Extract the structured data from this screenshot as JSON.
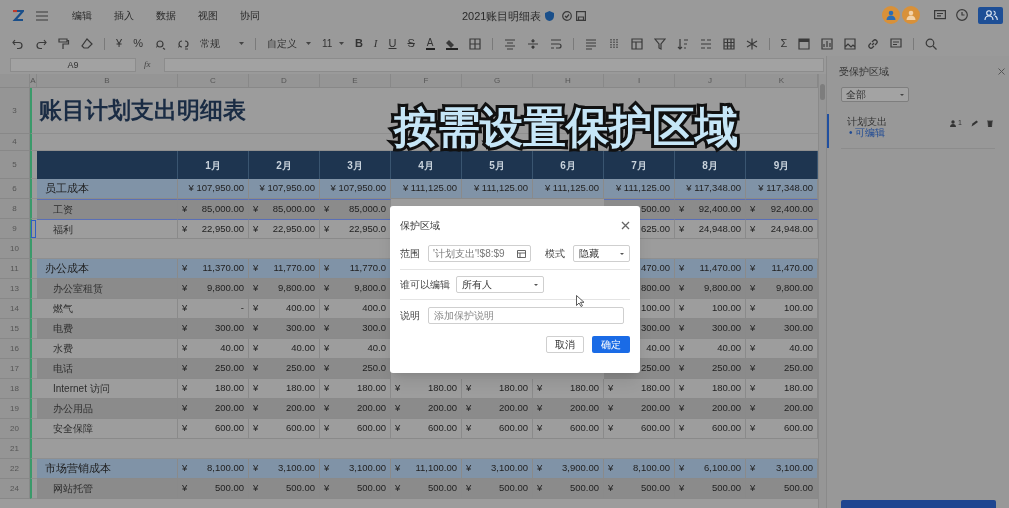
{
  "topbar": {
    "menus": [
      "编辑",
      "插入",
      "数据",
      "视图",
      "协同"
    ],
    "title": "2021账目明细表"
  },
  "toolbar": {
    "texts": [
      "¥",
      "%",
      "常规",
      "自定义",
      "11",
      "B",
      "I",
      "U",
      "S",
      "A",
      "Σ"
    ]
  },
  "formula_bar": {
    "cell": "A9",
    "fx": "fx"
  },
  "sheet": {
    "columns": [
      "A",
      "B",
      "C",
      "D",
      "E",
      "F",
      "G",
      "H",
      "I",
      "J",
      "K"
    ],
    "title_row": "3",
    "title": "账目计划支出明细表",
    "spacer_row": "4",
    "header_row": "5",
    "months": [
      "1月",
      "2月",
      "3月",
      "4月",
      "5月",
      "6月",
      "7月",
      "8月",
      "9月"
    ],
    "rows": [
      {
        "n": "6",
        "kind": "category",
        "label": "员工成本",
        "selected": false,
        "in_range": false,
        "cells": [
          "¥ 107,950.00",
          "¥ 107,950.00",
          "¥ 107,950.00",
          "¥ 111,125.00",
          "¥ 111,125.00",
          "¥ 111,125.00",
          "¥ 111,125.00",
          "¥ 117,348.00",
          "¥ 117,348.00"
        ]
      },
      {
        "n": "8",
        "kind": "item",
        "label": "工资",
        "selected": false,
        "in_range": true,
        "cells": [
          [
            "¥",
            "85,000.00"
          ],
          [
            "¥",
            "85,000.00"
          ],
          [
            "¥",
            "85,000.0"
          ],
          null,
          null,
          null,
          [
            "",
            "500.00"
          ],
          [
            "¥",
            "92,400.00"
          ],
          [
            "¥",
            "92,400.00"
          ]
        ]
      },
      {
        "n": "9",
        "kind": "item",
        "label": "福利",
        "selected": true,
        "in_range": true,
        "cells": [
          [
            "¥",
            "22,950.00"
          ],
          [
            "¥",
            "22,950.00"
          ],
          [
            "¥",
            "22,950.0"
          ],
          null,
          null,
          null,
          [
            "",
            "625.00"
          ],
          [
            "¥",
            "24,948.00"
          ],
          [
            "¥",
            "24,948.00"
          ]
        ]
      },
      {
        "n": "10",
        "kind": "blank",
        "selected": false,
        "in_range": false
      },
      {
        "n": "11",
        "kind": "category",
        "label": "办公成本",
        "selected": false,
        "in_range": false,
        "cells": [
          [
            "¥",
            "11,370.00"
          ],
          [
            "¥",
            "11,770.00"
          ],
          [
            "¥",
            "11,770.0"
          ],
          null,
          null,
          null,
          [
            "",
            "470.00"
          ],
          [
            "¥",
            "11,470.00"
          ],
          [
            "¥",
            "11,470.00"
          ]
        ]
      },
      {
        "n": "13",
        "kind": "item",
        "label": "办公室租赁",
        "selected": false,
        "in_range": false,
        "cells": [
          [
            "¥",
            "9,800.00"
          ],
          [
            "¥",
            "9,800.00"
          ],
          [
            "¥",
            "9,800.0"
          ],
          null,
          null,
          null,
          [
            "",
            "800.00"
          ],
          [
            "¥",
            "9,800.00"
          ],
          [
            "¥",
            "9,800.00"
          ]
        ]
      },
      {
        "n": "14",
        "kind": "item",
        "label": "燃气",
        "selected": false,
        "in_range": false,
        "cells": [
          [
            "¥",
            "-"
          ],
          [
            "¥",
            "400.00"
          ],
          [
            "¥",
            "400.0"
          ],
          null,
          null,
          null,
          [
            "",
            "100.00"
          ],
          [
            "¥",
            "100.00"
          ],
          [
            "¥",
            "100.00"
          ]
        ]
      },
      {
        "n": "15",
        "kind": "item",
        "label": "电费",
        "selected": false,
        "in_range": false,
        "cells": [
          [
            "¥",
            "300.00"
          ],
          [
            "¥",
            "300.00"
          ],
          [
            "¥",
            "300.0"
          ],
          null,
          null,
          null,
          [
            "",
            "300.00"
          ],
          [
            "¥",
            "300.00"
          ],
          [
            "¥",
            "300.00"
          ]
        ]
      },
      {
        "n": "16",
        "kind": "item",
        "label": "水费",
        "selected": false,
        "in_range": false,
        "cells": [
          [
            "¥",
            "40.00"
          ],
          [
            "¥",
            "40.00"
          ],
          [
            "¥",
            "40.0"
          ],
          null,
          null,
          null,
          [
            "",
            "40.00"
          ],
          [
            "¥",
            "40.00"
          ],
          [
            "¥",
            "40.00"
          ]
        ]
      },
      {
        "n": "17",
        "kind": "item",
        "label": "电话",
        "selected": false,
        "in_range": false,
        "cells": [
          [
            "¥",
            "250.00"
          ],
          [
            "¥",
            "250.00"
          ],
          [
            "¥",
            "250.0"
          ],
          null,
          null,
          null,
          [
            "",
            "250.00"
          ],
          [
            "¥",
            "250.00"
          ],
          [
            "¥",
            "250.00"
          ]
        ]
      },
      {
        "n": "18",
        "kind": "item",
        "label": "Internet 访问",
        "selected": false,
        "in_range": false,
        "cells": [
          [
            "¥",
            "180.00"
          ],
          [
            "¥",
            "180.00"
          ],
          [
            "¥",
            "180.00"
          ],
          [
            "¥",
            "180.00"
          ],
          [
            "¥",
            "180.00"
          ],
          [
            "¥",
            "180.00"
          ],
          [
            "¥",
            "180.00"
          ],
          [
            "¥",
            "180.00"
          ],
          [
            "¥",
            "180.00"
          ]
        ]
      },
      {
        "n": "19",
        "kind": "item",
        "label": "办公用品",
        "selected": false,
        "in_range": false,
        "cells": [
          [
            "¥",
            "200.00"
          ],
          [
            "¥",
            "200.00"
          ],
          [
            "¥",
            "200.00"
          ],
          [
            "¥",
            "200.00"
          ],
          [
            "¥",
            "200.00"
          ],
          [
            "¥",
            "200.00"
          ],
          [
            "¥",
            "200.00"
          ],
          [
            "¥",
            "200.00"
          ],
          [
            "¥",
            "200.00"
          ]
        ]
      },
      {
        "n": "20",
        "kind": "item",
        "label": "安全保障",
        "selected": false,
        "in_range": false,
        "cells": [
          [
            "¥",
            "600.00"
          ],
          [
            "¥",
            "600.00"
          ],
          [
            "¥",
            "600.00"
          ],
          [
            "¥",
            "600.00"
          ],
          [
            "¥",
            "600.00"
          ],
          [
            "¥",
            "600.00"
          ],
          [
            "¥",
            "600.00"
          ],
          [
            "¥",
            "600.00"
          ],
          [
            "¥",
            "600.00"
          ]
        ]
      },
      {
        "n": "21",
        "kind": "blank",
        "selected": false,
        "in_range": false
      },
      {
        "n": "22",
        "kind": "category",
        "label": "市场营销成本",
        "selected": false,
        "in_range": false,
        "cells": [
          [
            "¥",
            "8,100.00"
          ],
          [
            "¥",
            "3,100.00"
          ],
          [
            "¥",
            "3,100.00"
          ],
          [
            "¥",
            "11,100.00"
          ],
          [
            "¥",
            "3,100.00"
          ],
          [
            "¥",
            "3,900.00"
          ],
          [
            "¥",
            "8,100.00"
          ],
          [
            "¥",
            "6,100.00"
          ],
          [
            "¥",
            "3,100.00"
          ]
        ]
      },
      {
        "n": "24",
        "kind": "item",
        "label": "网站托管",
        "selected": false,
        "in_range": false,
        "cells": [
          [
            "¥",
            "500.00"
          ],
          [
            "¥",
            "500.00"
          ],
          [
            "¥",
            "500.00"
          ],
          [
            "¥",
            "500.00"
          ],
          [
            "¥",
            "500.00"
          ],
          [
            "¥",
            "500.00"
          ],
          [
            "¥",
            "500.00"
          ],
          [
            "¥",
            "500.00"
          ],
          [
            "¥",
            "500.00"
          ]
        ]
      }
    ]
  },
  "caption": "按需设置保护区域",
  "dialog": {
    "title": "保护区域",
    "range_label": "范围",
    "range_value": "'计划支出'!$8:$9",
    "mode_label": "模式",
    "mode_value": "隐藏",
    "editor_label": "谁可以编辑",
    "editor_value": "所有人",
    "note_label": "说明",
    "note_placeholder": "添加保护说明",
    "cancel": "取消",
    "ok": "确定"
  },
  "panel": {
    "title": "受保护区域",
    "filter": "全部",
    "items": [
      {
        "name": "计划支出",
        "status": "• 可编辑",
        "count": "1"
      }
    ]
  }
}
